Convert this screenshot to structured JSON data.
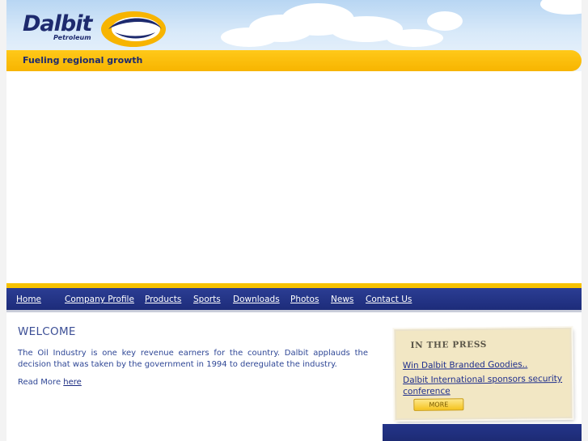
{
  "header": {
    "logo_name": "Dalbit",
    "logo_sub": "Petroleum",
    "tagline": "Fueling regional growth",
    "colors": {
      "navy": "#1d2a6e",
      "yellow": "#ffc91a",
      "sky": "#b8d6f3"
    }
  },
  "nav": {
    "items": [
      {
        "label": "Home"
      },
      {
        "label": "Company Profile"
      },
      {
        "label": "Products"
      },
      {
        "label": "Sports"
      },
      {
        "label": "Downloads"
      },
      {
        "label": "Photos"
      },
      {
        "label": "News"
      },
      {
        "label": "Contact Us"
      }
    ],
    "background": "#1d2c7a"
  },
  "welcome": {
    "title": "WELCOME",
    "body": "The Oil Industry is one key revenue earners for the country. Dalbit applauds the decision that was taken by the government in 1994 to deregulate the industry.",
    "read_more_prefix": "Read More ",
    "read_more_link": "here"
  },
  "press": {
    "title": "IN THE PRESS",
    "items": [
      {
        "label": "Win Dalbit Branded Goodies.."
      },
      {
        "label": "Dalbit International sponsors security conference"
      }
    ],
    "more_label": "MORE"
  }
}
